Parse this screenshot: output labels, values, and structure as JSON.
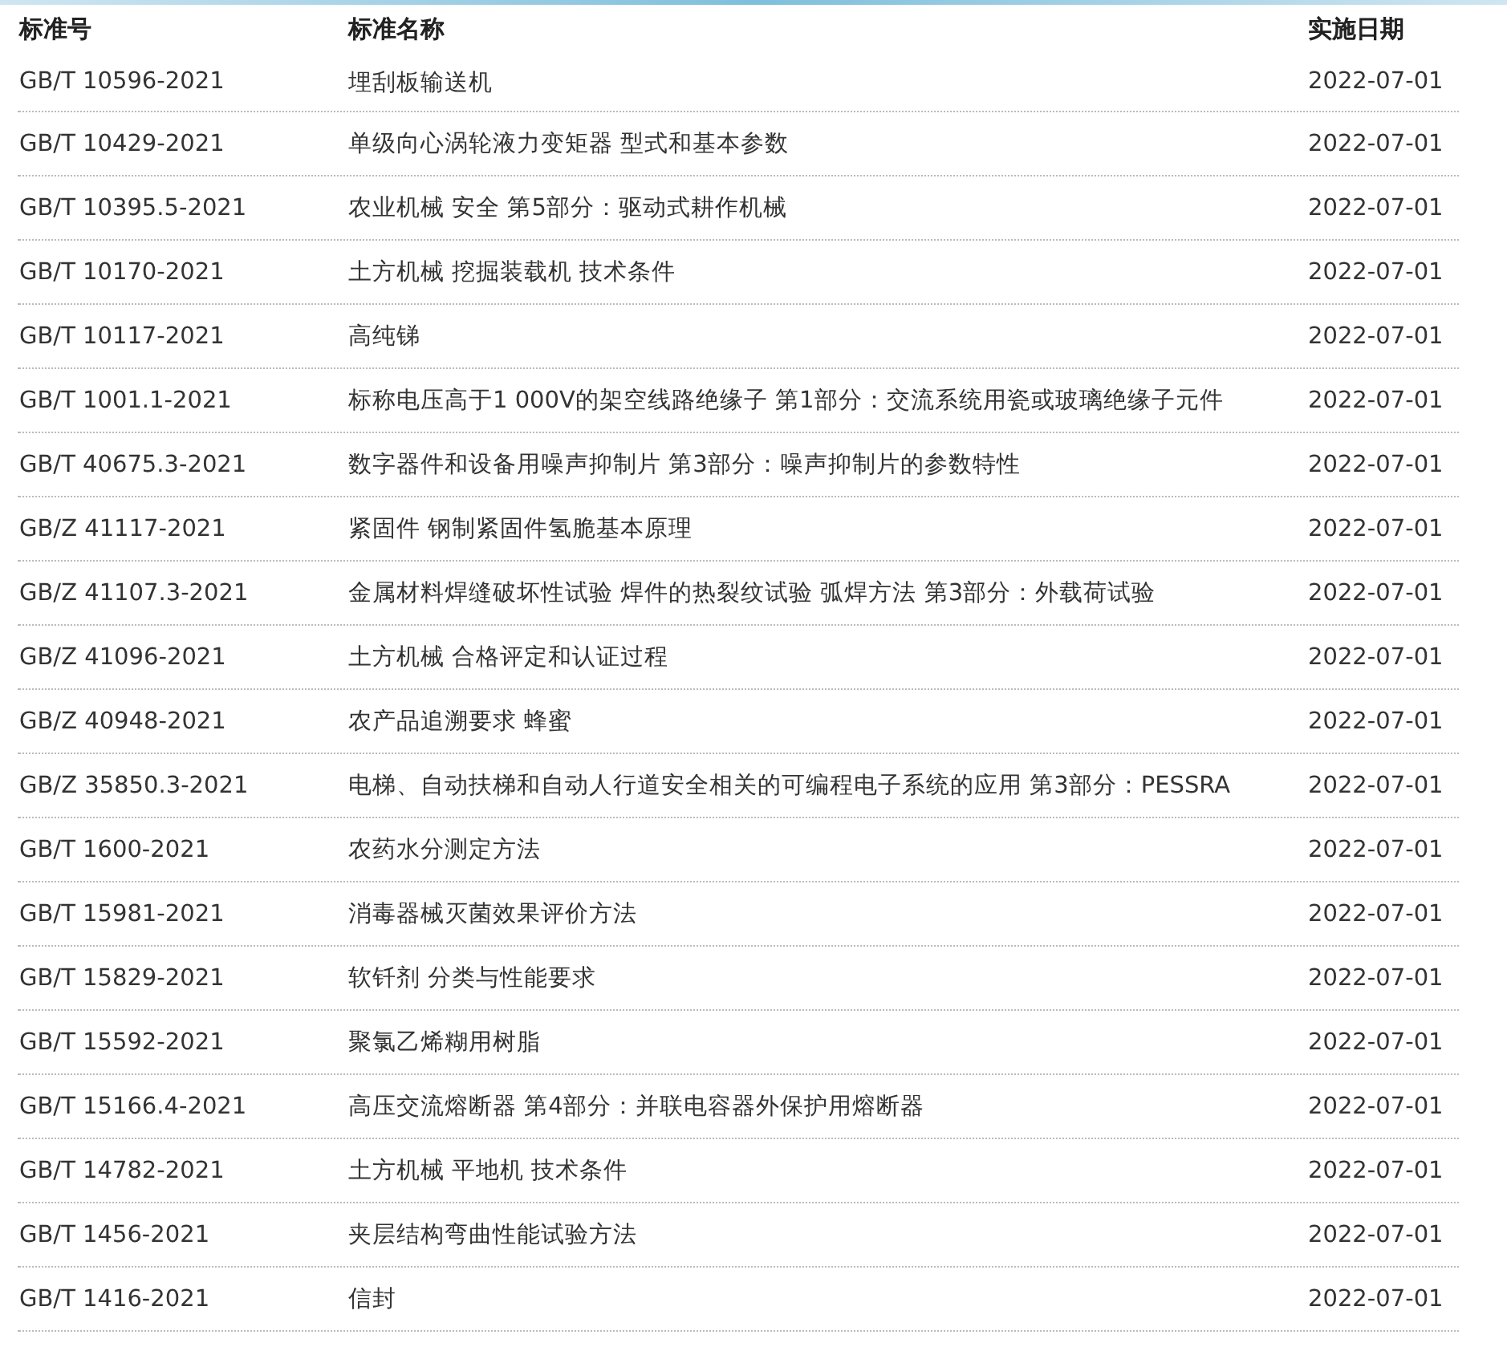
{
  "table": {
    "columns": [
      "标准号",
      "标准名称",
      "实施日期"
    ],
    "rows": [
      [
        "GB/T 10596-2021",
        "埋刮板输送机",
        "2022-07-01"
      ],
      [
        "GB/T 10429-2021",
        "单级向心涡轮液力变矩器 型式和基本参数",
        "2022-07-01"
      ],
      [
        "GB/T 10395.5-2021",
        "农业机械 安全 第5部分：驱动式耕作机械",
        "2022-07-01"
      ],
      [
        "GB/T 10170-2021",
        "土方机械 挖掘装载机 技术条件",
        "2022-07-01"
      ],
      [
        "GB/T 10117-2021",
        "高纯锑",
        "2022-07-01"
      ],
      [
        "GB/T 1001.1-2021",
        "标称电压高于1 000V的架空线路绝缘子 第1部分：交流系统用瓷或玻璃绝缘子元件",
        "2022-07-01"
      ],
      [
        "GB/T 40675.3-2021",
        "数字器件和设备用噪声抑制片 第3部分：噪声抑制片的参数特性",
        "2022-07-01"
      ],
      [
        "GB/Z 41117-2021",
        "紧固件 钢制紧固件氢脆基本原理",
        "2022-07-01"
      ],
      [
        "GB/Z 41107.3-2021",
        "金属材料焊缝破坏性试验 焊件的热裂纹试验 弧焊方法 第3部分：外载荷试验",
        "2022-07-01"
      ],
      [
        "GB/Z 41096-2021",
        "土方机械 合格评定和认证过程",
        "2022-07-01"
      ],
      [
        "GB/Z 40948-2021",
        "农产品追溯要求 蜂蜜",
        "2022-07-01"
      ],
      [
        "GB/Z 35850.3-2021",
        "电梯、自动扶梯和自动人行道安全相关的可编程电子系统的应用 第3部分：PESSRA",
        "2022-07-01"
      ],
      [
        "GB/T 1600-2021",
        "农药水分测定方法",
        "2022-07-01"
      ],
      [
        "GB/T 15981-2021",
        "消毒器械灭菌效果评价方法",
        "2022-07-01"
      ],
      [
        "GB/T 15829-2021",
        "软钎剂 分类与性能要求",
        "2022-07-01"
      ],
      [
        "GB/T 15592-2021",
        "聚氯乙烯糊用树脂",
        "2022-07-01"
      ],
      [
        "GB/T 15166.4-2021",
        "高压交流熔断器 第4部分：并联电容器外保护用熔断器",
        "2022-07-01"
      ],
      [
        "GB/T 14782-2021",
        "土方机械 平地机 技术条件",
        "2022-07-01"
      ],
      [
        "GB/T 1456-2021",
        "夹层结构弯曲性能试验方法",
        "2022-07-01"
      ],
      [
        "GB/T 1416-2021",
        "信封",
        "2022-07-01"
      ]
    ]
  }
}
